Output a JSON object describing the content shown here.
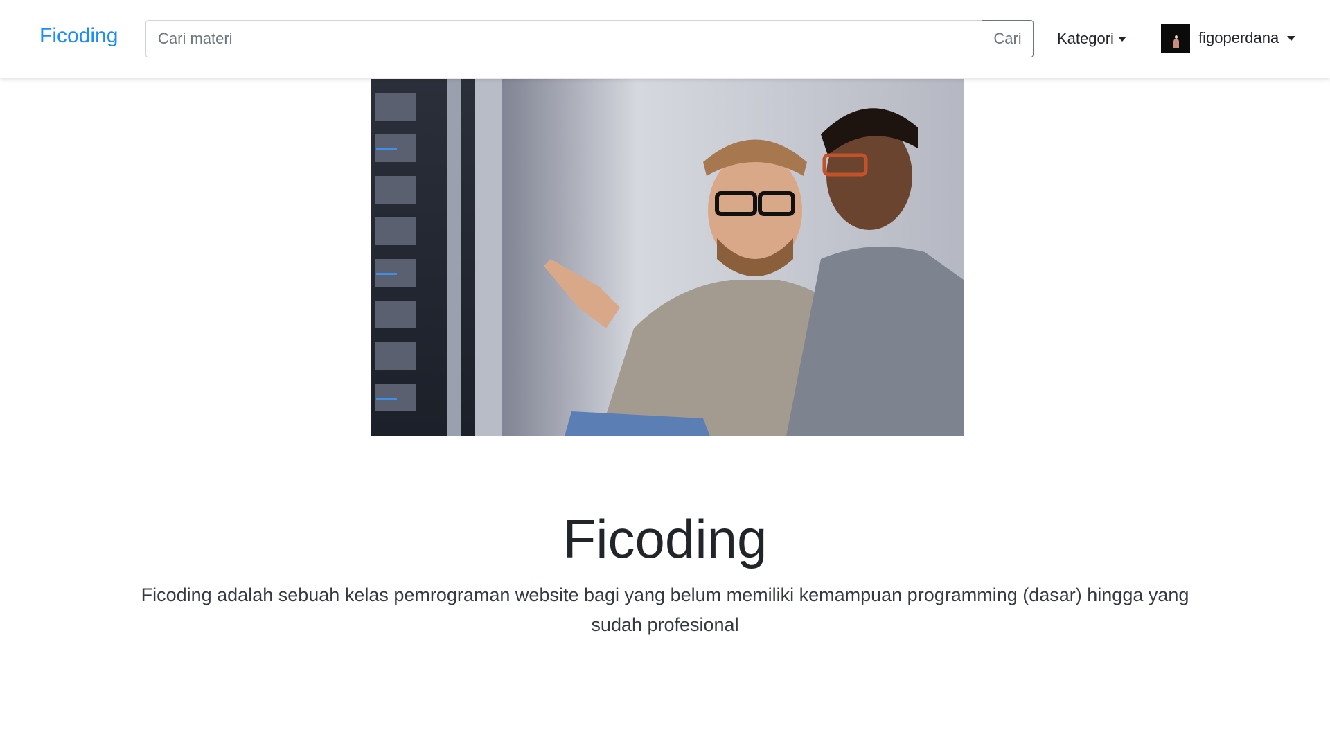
{
  "navbar": {
    "brand": "Ficoding",
    "search": {
      "placeholder": "Cari materi",
      "value": "",
      "button_label": "Cari"
    },
    "category_menu": {
      "label": "Kategori"
    },
    "user_menu": {
      "username": "figoperdana"
    }
  },
  "hero": {
    "title": "Ficoding",
    "description": "Ficoding adalah sebuah kelas pemrograman website bagi yang belum memiliki kemampuan programming (dasar) hingga yang sudah profesional"
  },
  "colors": {
    "brand": "#1a8cff",
    "navbar_bg": "#ffffff",
    "button_outline": "#6c757d"
  }
}
